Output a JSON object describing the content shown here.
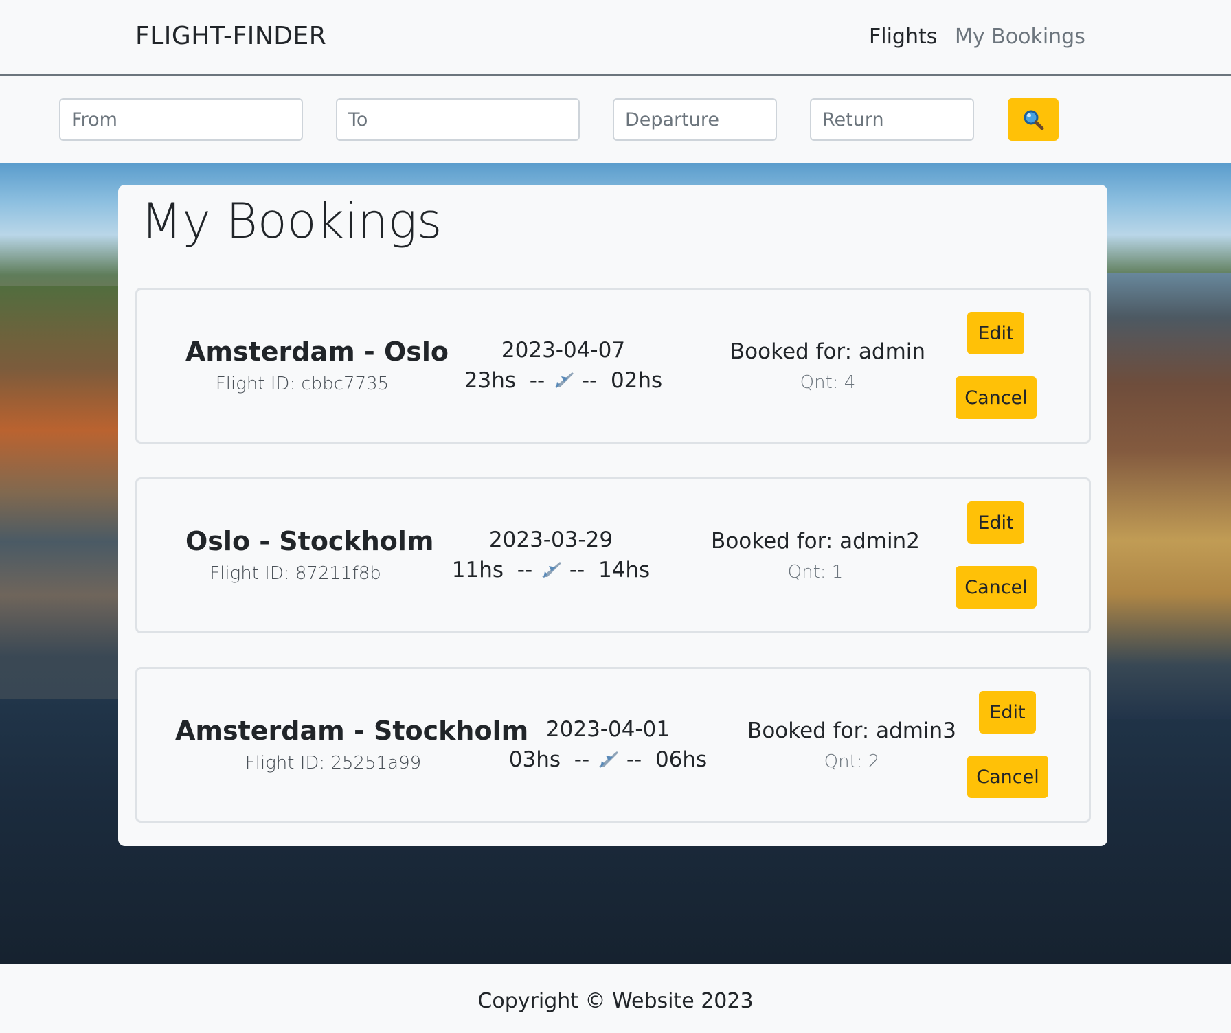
{
  "navbar": {
    "brand": "FLIGHT-FINDER",
    "links": [
      "Flights",
      "My Bookings"
    ]
  },
  "search": {
    "from_placeholder": "From",
    "to_placeholder": "To",
    "departure_placeholder": "Departure",
    "return_placeholder": "Return",
    "button_icon": "search-icon"
  },
  "page_title": "My Bookings",
  "bookings": [
    {
      "route": "Amsterdam - Oslo",
      "flight_id": "Flight ID: cbbc7735",
      "date": "2023-04-07",
      "times": {
        "departure": "23hs",
        "sep1": "--",
        "sep2": "--",
        "arrival": "02hs"
      },
      "booked_for": "Booked for: admin",
      "qnt": "Qnt: 4",
      "edit_label": "Edit",
      "cancel_label": "Cancel"
    },
    {
      "route": "Oslo - Stockholm",
      "flight_id": "Flight ID: 87211f8b",
      "date": "2023-03-29",
      "times": {
        "departure": "11hs",
        "sep1": "--",
        "sep2": "--",
        "arrival": "14hs"
      },
      "booked_for": "Booked for: admin2",
      "qnt": "Qnt: 1",
      "edit_label": "Edit",
      "cancel_label": "Cancel"
    },
    {
      "route": "Amsterdam - Stockholm",
      "flight_id": "Flight ID: 25251a99",
      "date": "2023-04-01",
      "times": {
        "departure": "03hs",
        "sep1": "--",
        "sep2": "--",
        "arrival": "06hs"
      },
      "booked_for": "Booked for: admin3",
      "qnt": "Qnt: 2",
      "edit_label": "Edit",
      "cancel_label": "Cancel"
    }
  ],
  "footer": {
    "text": "Copyright © Website 2023"
  },
  "colors": {
    "accent": "#ffc107",
    "background": "#f8f9fa",
    "text": "#212529",
    "muted": "#6c757d"
  }
}
